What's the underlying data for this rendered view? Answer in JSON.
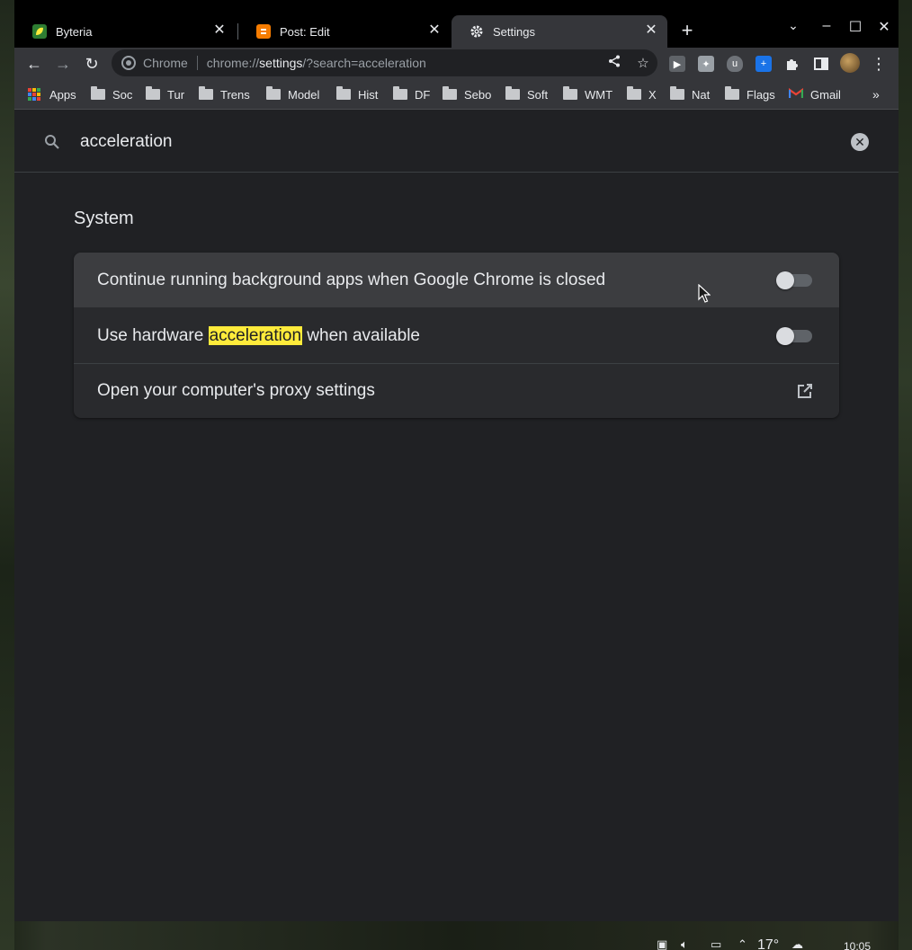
{
  "tabs": [
    {
      "title": "Byteria"
    },
    {
      "title": "Post: Edit"
    },
    {
      "title": "Settings"
    }
  ],
  "omnibox": {
    "chip": "Chrome",
    "url_scheme": "chrome://",
    "url_host": "settings",
    "url_path": "/?search=acceleration"
  },
  "bookmarks": [
    "Apps",
    "Soc",
    "Tur",
    "Trens",
    "Model",
    "Hist",
    "DF",
    "Sebo",
    "Soft",
    "WMT",
    "X",
    "Nat",
    "Flags",
    "Gmail"
  ],
  "search": {
    "value": "acceleration"
  },
  "section": {
    "title": "System"
  },
  "settings": [
    {
      "label": "Continue running background apps when Google Chrome is closed",
      "enabled": false
    },
    {
      "label_before": "Use hardware ",
      "label_highlight": "acceleration",
      "label_after": " when available",
      "enabled": false
    },
    {
      "label": "Open your computer's proxy settings"
    }
  ],
  "taskbar": {
    "temperature": "17°",
    "time": "10:05"
  },
  "colors": {
    "accent_highlight": "#ffeb3b",
    "background": "#202124",
    "card": "#292a2d"
  }
}
